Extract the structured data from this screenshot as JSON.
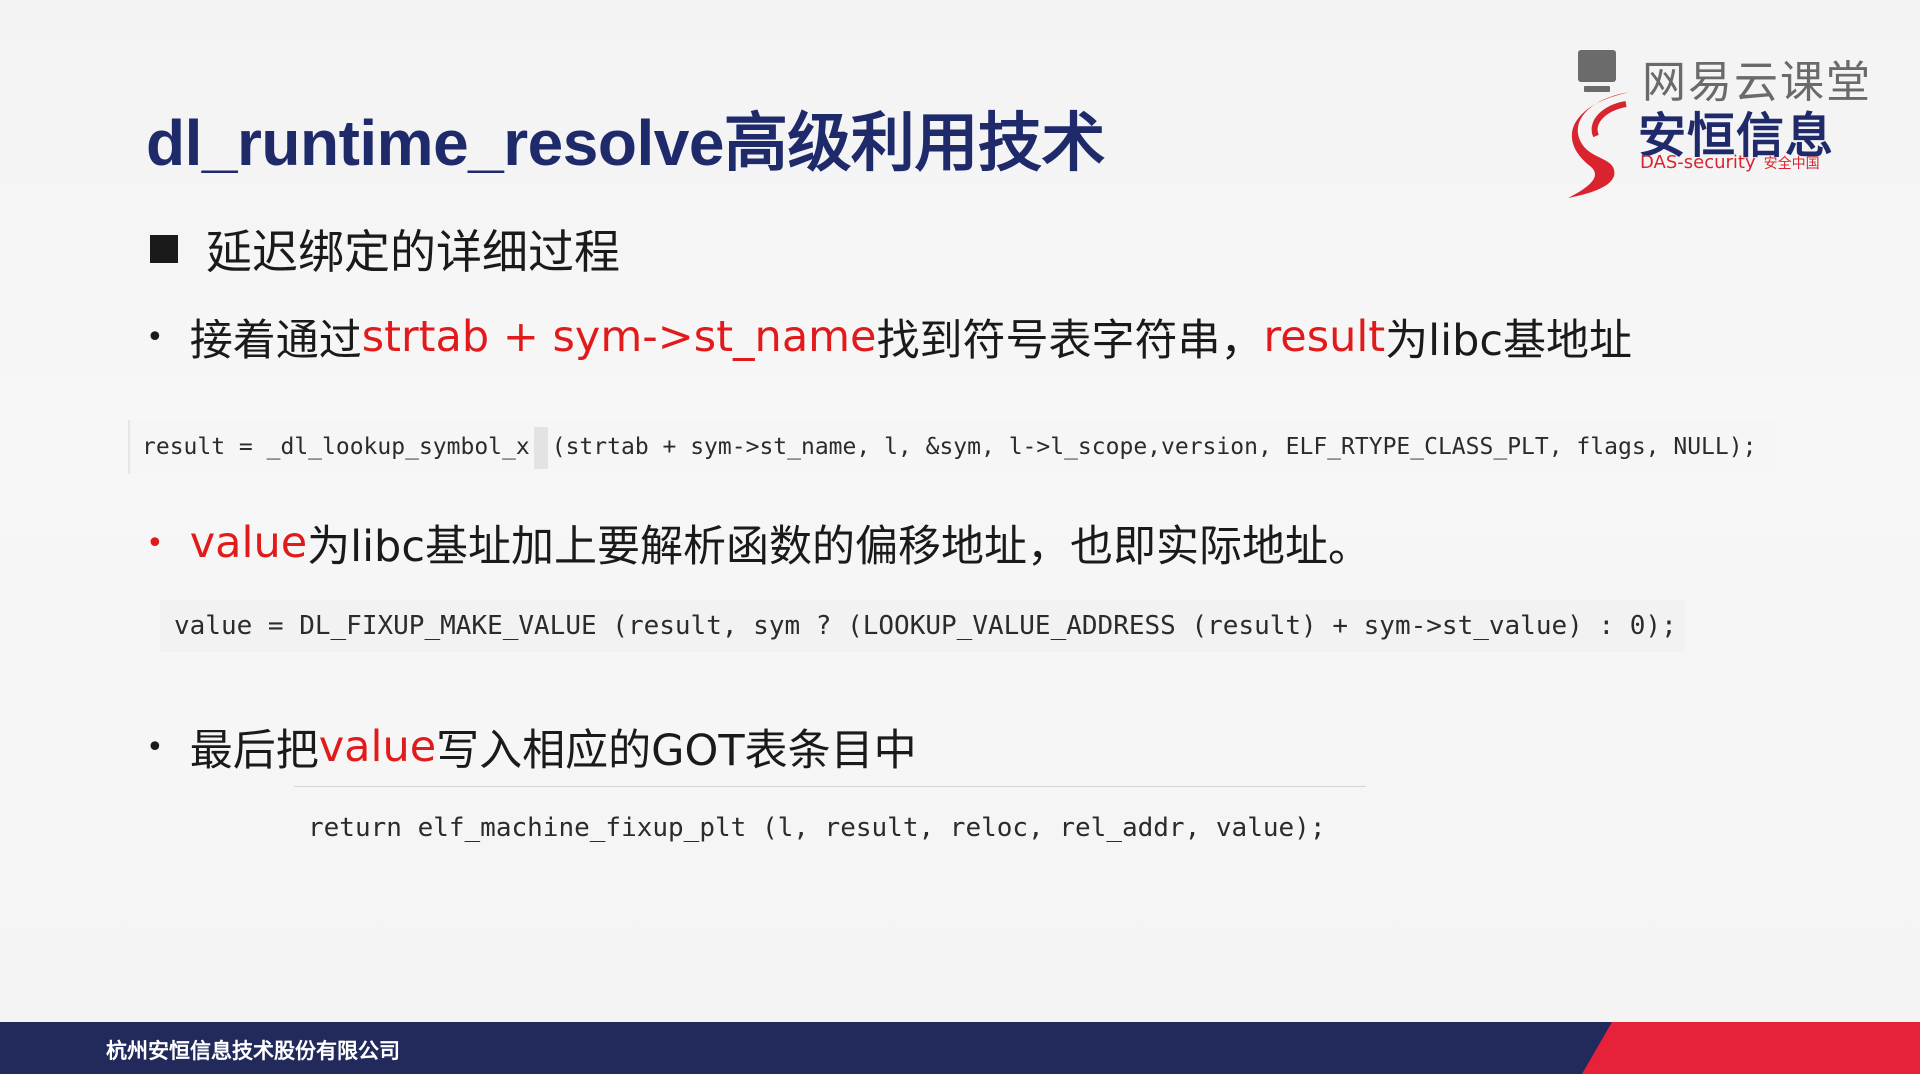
{
  "slide": {
    "title": "dl_runtime_resolve高级利用技术",
    "logo": {
      "brand_top": "网易云课堂",
      "brand_main": "安恒信息",
      "brand_sub": "DAS-security",
      "brand_sub_cn": "安全中国"
    },
    "section": "延迟绑定的详细过程",
    "bullets": [
      {
        "parts": [
          "接着通过",
          "strtab + sym->st_name",
          "找到符号表字符串，",
          "result",
          "为libc基地址"
        ]
      },
      {
        "parts": [
          "value",
          "为libc基址加上要解析函数的偏移地址，也即实际地址。"
        ]
      },
      {
        "parts": [
          "最后把",
          "value",
          "写入相应的GOT表条目中"
        ]
      }
    ],
    "code": [
      {
        "left": "result = _dl_lookup_symbol_x",
        "right": "(strtab + sym->st_name, l, &sym, l->l_scope,version, ELF_RTYPE_CLASS_PLT, flags, NULL);"
      },
      {
        "text": "value = DL_FIXUP_MAKE_VALUE (result, sym ? (LOOKUP_VALUE_ADDRESS (result) + sym->st_value) : 0);"
      },
      {
        "text": "return elf_machine_fixup_plt (l, result, reloc, rel_addr, value);"
      }
    ],
    "footer": {
      "company": "杭州安恒信息技术股份有限公司"
    }
  },
  "colors": {
    "title": "#1f2a6b",
    "highlight": "#e11b1b",
    "footer_navy": "#222a5c",
    "footer_red": "#e8213a"
  }
}
